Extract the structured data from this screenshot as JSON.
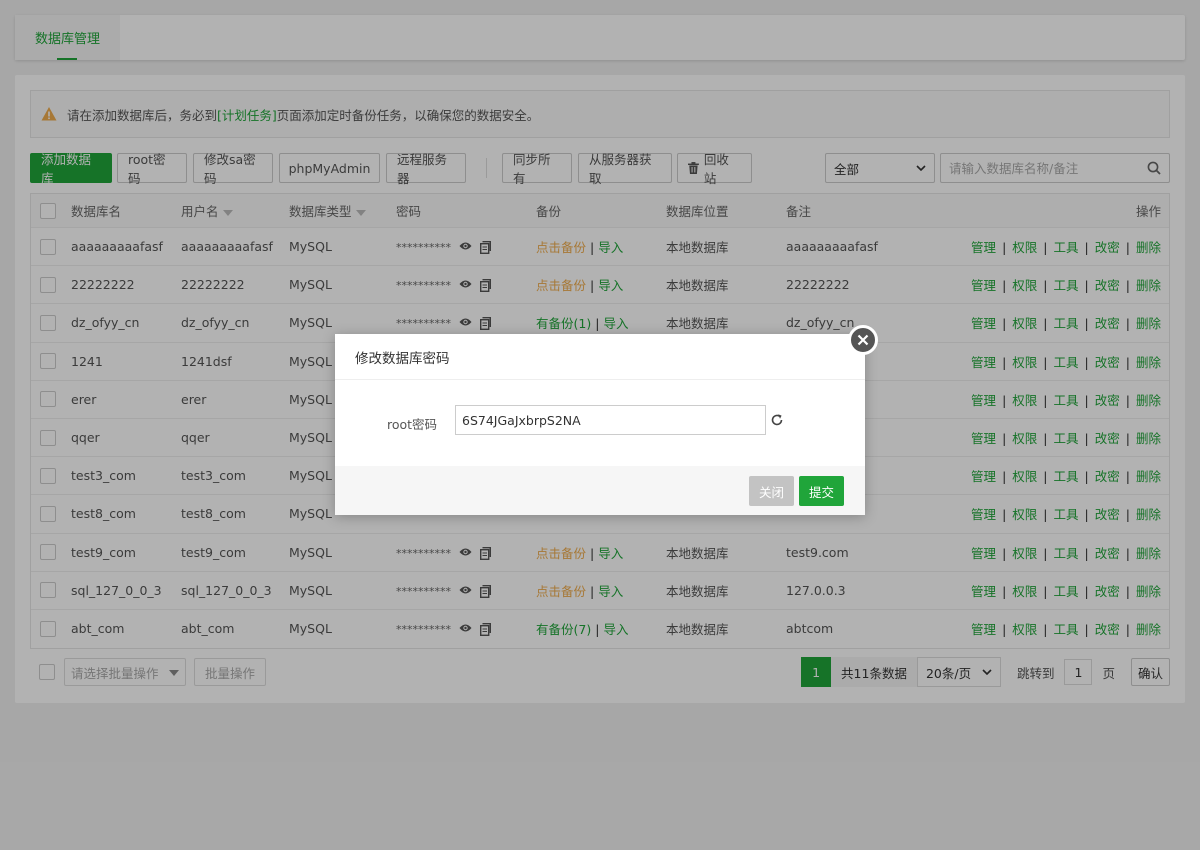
{
  "tabs": [
    {
      "label": "数据库管理",
      "active": true
    }
  ],
  "alert": {
    "prefix": "请在添加数据库后，务必到",
    "link": "[计划任务]",
    "suffix": "页面添加定时备份任务，以确保您的数据安全。"
  },
  "toolbar": {
    "add_db": "添加数据库",
    "root_pw": "root密码",
    "sa_pw": "修改sa密码",
    "phpmyadmin": "phpMyAdmin",
    "remote": "远程服务器",
    "sync_all": "同步所有",
    "fetch": "从服务器获取",
    "recycle": "回收站",
    "filter_value": "全部",
    "search_placeholder": "请输入数据库名称/备注"
  },
  "table": {
    "headers": {
      "name": "数据库名",
      "user": "用户名",
      "type": "数据库类型",
      "pass": "密码",
      "backup": "备份",
      "location": "数据库位置",
      "note": "备注",
      "ops": "操作"
    },
    "ops_labels": [
      "管理",
      "权限",
      "工具",
      "改密",
      "删除"
    ],
    "import_label": "导入",
    "rows": [
      {
        "name": "aaaaaaaaafasf",
        "user": "aaaaaaaaafasf",
        "type": "MySQL",
        "pass": "**********",
        "backup": "点击备份",
        "backup_status": "none",
        "location": "本地数据库",
        "note": "aaaaaaaaafasf"
      },
      {
        "name": "22222222",
        "user": "22222222",
        "type": "MySQL",
        "pass": "**********",
        "backup": "点击备份",
        "backup_status": "none",
        "location": "本地数据库",
        "note": "22222222"
      },
      {
        "name": "dz_ofyy_cn",
        "user": "dz_ofyy_cn",
        "type": "MySQL",
        "pass": "**********",
        "backup": "有备份(1)",
        "backup_status": "has",
        "location": "本地数据库",
        "note": "dz_ofyy_cn"
      },
      {
        "name": "1241",
        "user": "1241dsf",
        "type": "MySQL",
        "pass": "",
        "backup": "",
        "backup_status": "hidden",
        "location": "",
        "note": ""
      },
      {
        "name": "erer",
        "user": "erer",
        "type": "MySQL",
        "pass": "",
        "backup": "",
        "backup_status": "hidden",
        "location": "",
        "note": ""
      },
      {
        "name": "qqer",
        "user": "qqer",
        "type": "MySQL",
        "pass": "",
        "backup": "",
        "backup_status": "hidden",
        "location": "",
        "note": ""
      },
      {
        "name": "test3_com",
        "user": "test3_com",
        "type": "MySQL",
        "pass": "",
        "backup": "",
        "backup_status": "hidden",
        "location": "",
        "note": ""
      },
      {
        "name": "test8_com",
        "user": "test8_com",
        "type": "MySQL",
        "pass": "",
        "backup": "",
        "backup_status": "hidden",
        "location": "",
        "note": ""
      },
      {
        "name": "test9_com",
        "user": "test9_com",
        "type": "MySQL",
        "pass": "**********",
        "backup": "点击备份",
        "backup_status": "none",
        "location": "本地数据库",
        "note": "test9.com"
      },
      {
        "name": "sql_127_0_0_3",
        "user": "sql_127_0_0_3",
        "type": "MySQL",
        "pass": "**********",
        "backup": "点击备份",
        "backup_status": "none",
        "location": "本地数据库",
        "note": "127.0.0.3"
      },
      {
        "name": "abt_com",
        "user": "abt_com",
        "type": "MySQL",
        "pass": "**********",
        "backup": "有备份(7)",
        "backup_status": "has",
        "location": "本地数据库",
        "note": "abtcom"
      }
    ]
  },
  "footer": {
    "batch_placeholder": "请选择批量操作",
    "batch_button": "批量操作",
    "current_page": "1",
    "total": "共11条数据",
    "per_page": "20条/页",
    "jump_label": "跳转到",
    "jump_value": "1",
    "page_unit": "页",
    "confirm": "确认"
  },
  "dialog": {
    "title": "修改数据库密码",
    "field_label": "root密码",
    "field_value": "6S74JGaJxbrpS2NA",
    "close_label": "关闭",
    "submit_label": "提交"
  },
  "colors": {
    "brand": "#20a53a",
    "warning": "#f0ad4e"
  }
}
